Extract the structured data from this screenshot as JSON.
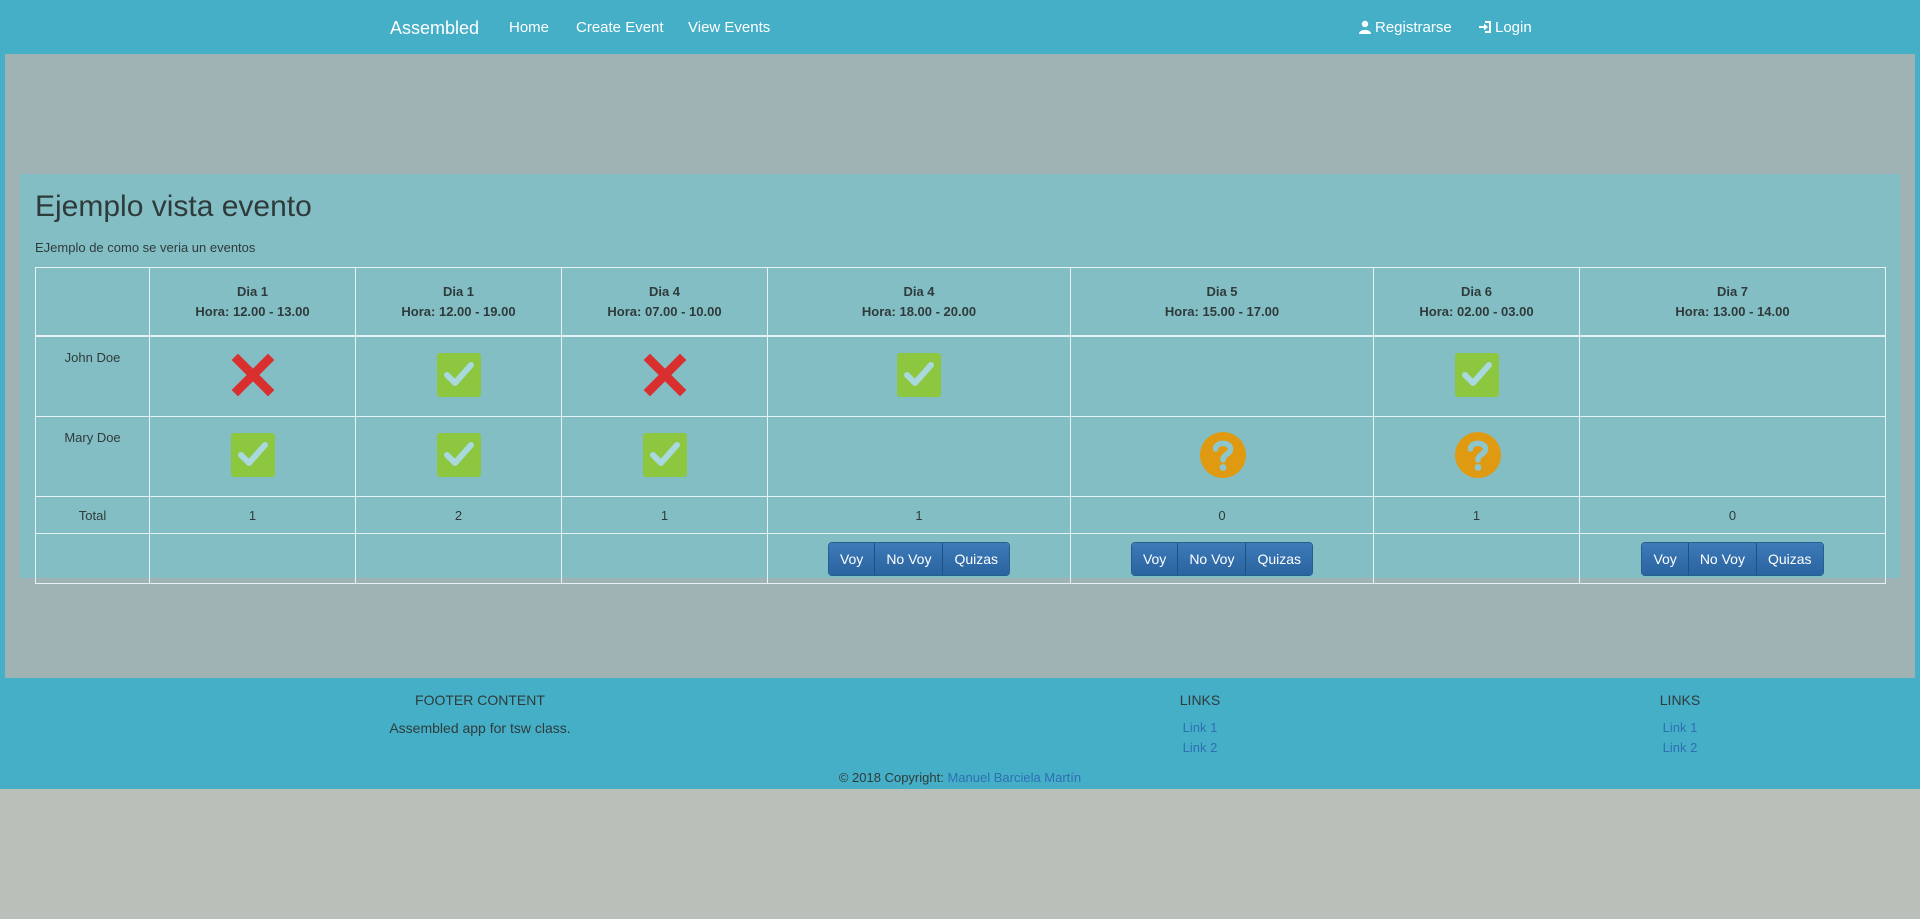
{
  "nav": {
    "brand": "Assembled",
    "links": [
      "Home",
      "Create Event",
      "View Events"
    ],
    "register": "Registrarse",
    "login": "Login",
    "register_icon": "user-icon",
    "login_icon": "login-icon"
  },
  "event": {
    "title": "Ejemplo vista evento",
    "subtitle": "EJemplo de como se veria un eventos",
    "slots": [
      {
        "day": "Dia 1",
        "time": "Hora: 12.00 - 13.00"
      },
      {
        "day": "Dia 1",
        "time": "Hora: 12.00 - 19.00"
      },
      {
        "day": "Dia 4",
        "time": "Hora: 07.00 - 10.00"
      },
      {
        "day": "Dia 4",
        "time": "Hora: 18.00 - 20.00"
      },
      {
        "day": "Dia 5",
        "time": "Hora: 15.00 - 17.00"
      },
      {
        "day": "Dia 6",
        "time": "Hora: 02.00 - 03.00"
      },
      {
        "day": "Dia 7",
        "time": "Hora: 13.00 - 14.00"
      }
    ],
    "people": [
      {
        "name": "John Doe",
        "status": [
          "no",
          "yes",
          "no",
          "yes",
          "",
          "yes",
          ""
        ]
      },
      {
        "name": "Mary Doe",
        "status": [
          "yes",
          "yes",
          "yes",
          "",
          "maybe",
          "maybe",
          ""
        ]
      }
    ],
    "total_label": "Total",
    "totals": [
      "1",
      "2",
      "1",
      "1",
      "0",
      "1",
      "0"
    ],
    "actions": [
      false,
      false,
      false,
      true,
      true,
      false,
      true
    ],
    "buttons": {
      "yes": "Voy",
      "no": "No Voy",
      "maybe": "Quizas"
    },
    "colors": {
      "yes": "#8dc63f",
      "no": "#d9302f",
      "maybe": "#e09a12"
    }
  },
  "footer": {
    "content_heading": "FOOTER CONTENT",
    "content_text": "Assembled app for tsw class.",
    "links1_heading": "LINKS",
    "links1": [
      "Link 1",
      "Link 2"
    ],
    "links2_heading": "LINKS",
    "links2": [
      "Link 1",
      "Link 2"
    ],
    "copyright_prefix": "© 2018 Copyright:",
    "copyright_author": "Manuel Barciela Martín"
  }
}
